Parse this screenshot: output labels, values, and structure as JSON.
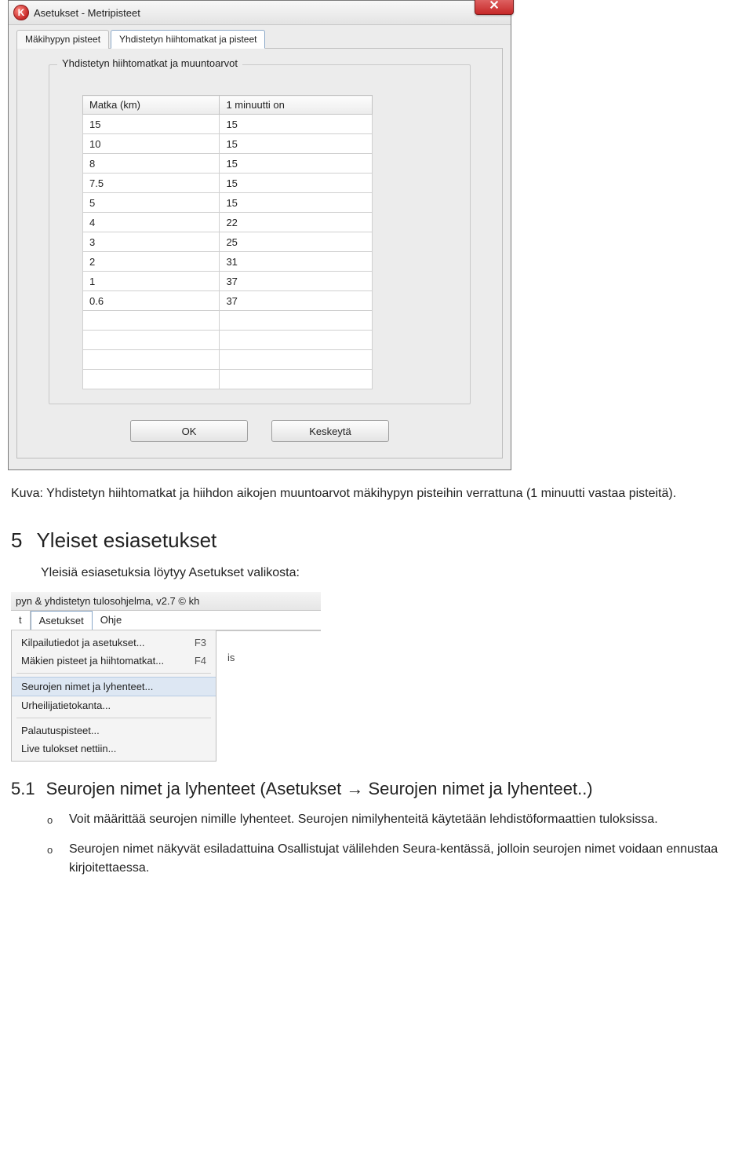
{
  "dialog": {
    "title": "Asetukset - Metripisteet",
    "icon_letter": "K",
    "tabs": {
      "pts": "Mäkihypyn pisteet",
      "combined": "Yhdistetyn hiihtomatkat ja pisteet"
    },
    "group_title": "Yhdistetyn hiihtomatkat ja muuntoarvot",
    "cols": {
      "c1": "Matka (km)",
      "c2": "1 minuutti on"
    },
    "rows": [
      {
        "km": "15",
        "pts": "15"
      },
      {
        "km": "10",
        "pts": "15"
      },
      {
        "km": "8",
        "pts": "15"
      },
      {
        "km": "7.5",
        "pts": "15"
      },
      {
        "km": "5",
        "pts": "15"
      },
      {
        "km": "4",
        "pts": "22"
      },
      {
        "km": "3",
        "pts": "25"
      },
      {
        "km": "2",
        "pts": "31"
      },
      {
        "km": "1",
        "pts": "37"
      },
      {
        "km": "0.6",
        "pts": "37"
      },
      {
        "km": "",
        "pts": ""
      },
      {
        "km": "",
        "pts": ""
      },
      {
        "km": "",
        "pts": ""
      },
      {
        "km": "",
        "pts": ""
      }
    ],
    "buttons": {
      "ok": "OK",
      "cancel": "Keskeytä"
    }
  },
  "caption": "Kuva: Yhdistetyn hiihtomatkat ja hiihdon aikojen muuntoarvot mäkihypyn pisteihin verrattuna (1 minuutti vastaa pisteitä).",
  "sec5": {
    "num": "5",
    "title": "Yleiset esiasetukset",
    "intro": "Yleisiä esiasetuksia löytyy Asetukset valikosta:"
  },
  "menu_shot": {
    "app_title": "pyn & yhdistetyn tulosohjelma, v2.7 © kh",
    "menubar": {
      "t": "t",
      "asetukset": "Asetukset",
      "ohje": "Ohje"
    },
    "items": [
      {
        "label": "Kilpailutiedot ja asetukset...",
        "key": "F3"
      },
      {
        "label": "Mäkien pisteet ja hiihtomatkat...",
        "key": "F4"
      }
    ],
    "hl": {
      "label": "Seurojen nimet ja lyhenteet..."
    },
    "items2": [
      {
        "label": "Urheilijatietokanta..."
      }
    ],
    "items3": [
      {
        "label": "Palautuspisteet..."
      },
      {
        "label": "Live tulokset nettiin..."
      }
    ],
    "side_text": "is"
  },
  "sec51": {
    "num": "5.1",
    "title": "Seurojen nimet ja lyhenteet (Asetukset → Seurojen nimet ja lyhenteet..)",
    "bullets": [
      "Voit määrittää seurojen nimille lyhenteet. Seurojen nimilyhenteitä käytetään lehdistöformaattien tuloksissa.",
      "Seurojen nimet näkyvät esiladattuina Osallistujat välilehden Seura-kentässä, jolloin seurojen nimet voidaan ennustaa kirjoitettaessa."
    ],
    "bullet_marker": "o"
  },
  "chart_data": {
    "type": "table",
    "title": "Yhdistetyn hiihtomatkat ja muuntoarvot",
    "columns": [
      "Matka (km)",
      "1 minuutti on"
    ],
    "rows": [
      [
        15,
        15
      ],
      [
        10,
        15
      ],
      [
        8,
        15
      ],
      [
        7.5,
        15
      ],
      [
        5,
        15
      ],
      [
        4,
        22
      ],
      [
        3,
        25
      ],
      [
        2,
        31
      ],
      [
        1,
        37
      ],
      [
        0.6,
        37
      ]
    ]
  }
}
